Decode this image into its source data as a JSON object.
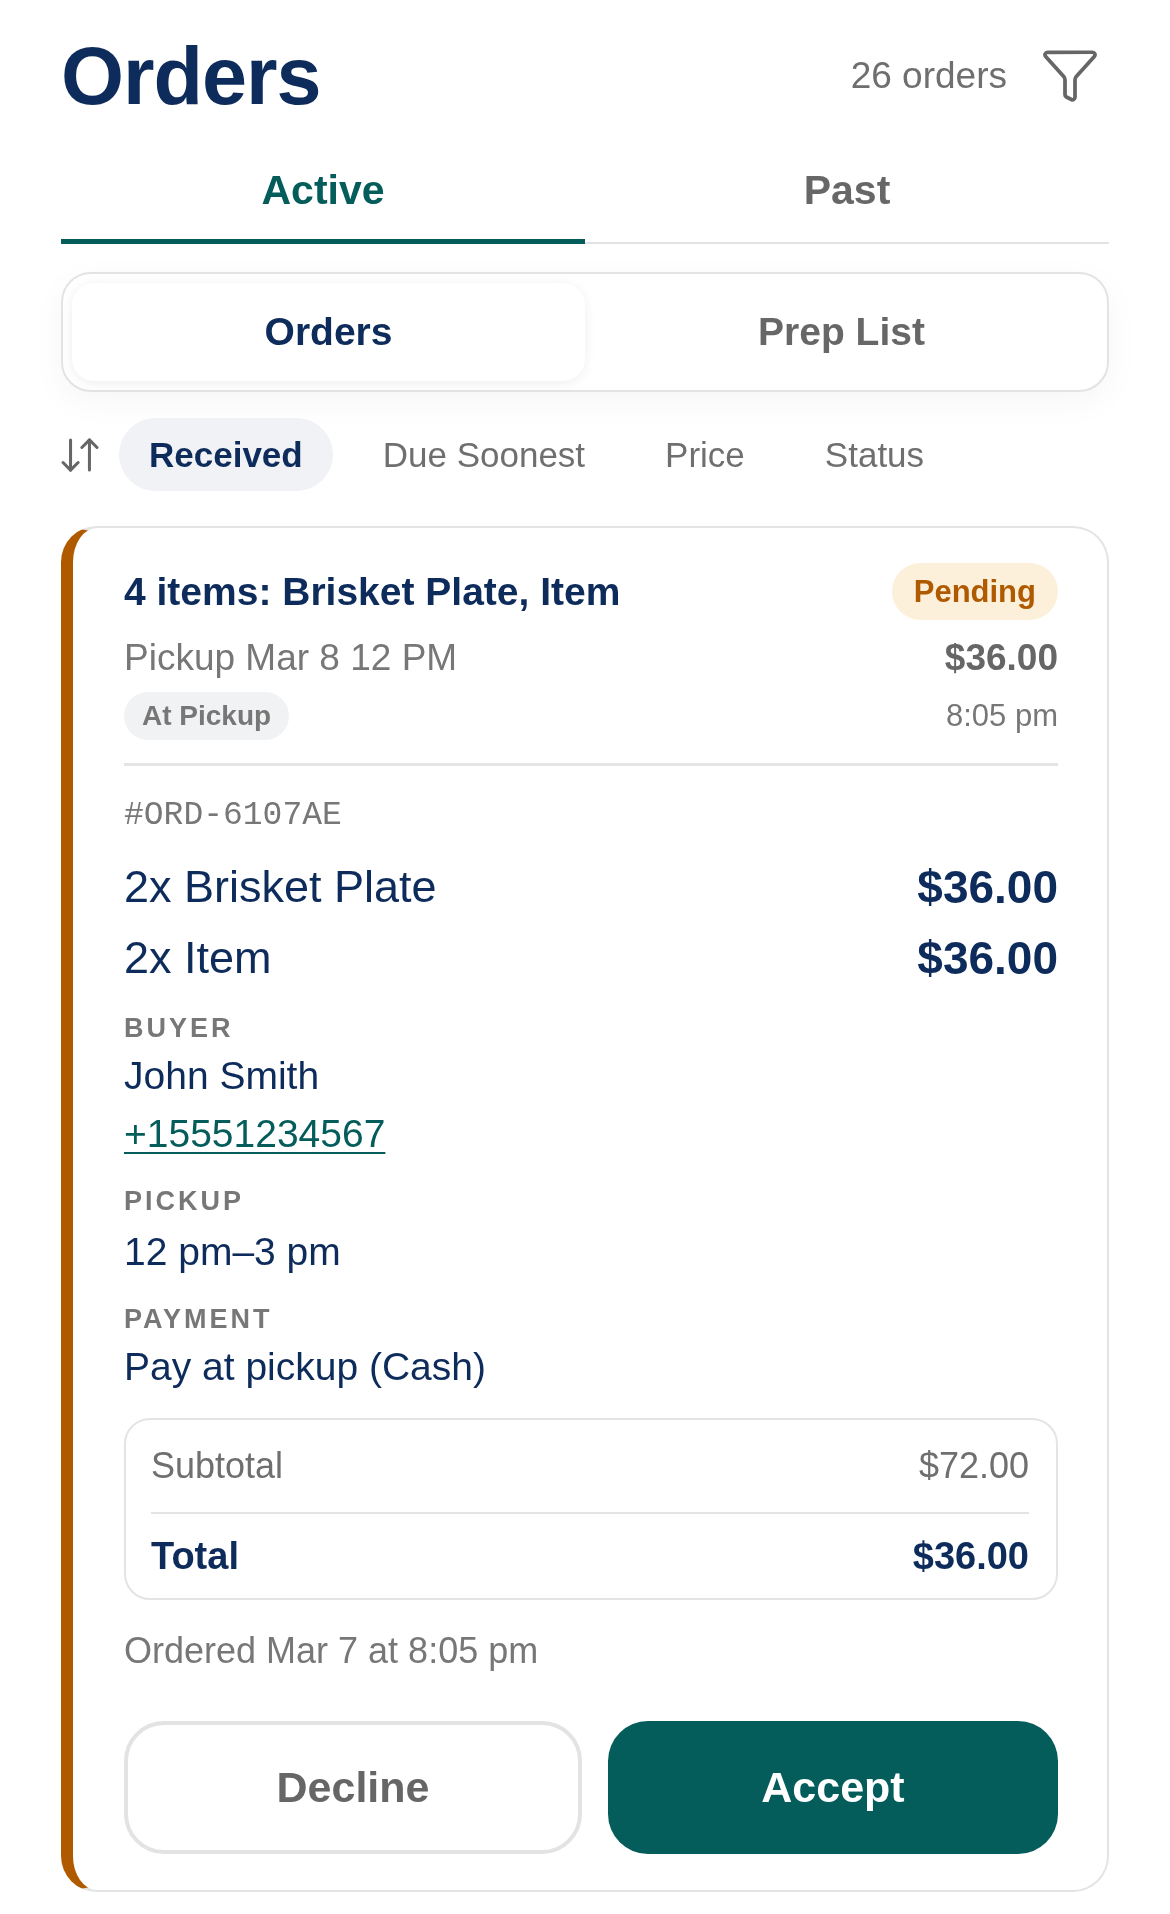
{
  "header": {
    "title": "Orders",
    "count": "26 orders"
  },
  "tabs": [
    {
      "label": "Active",
      "selected": true
    },
    {
      "label": "Past",
      "selected": false
    }
  ],
  "view_switch": [
    {
      "label": "Orders",
      "selected": true
    },
    {
      "label": "Prep List",
      "selected": false
    }
  ],
  "sort_options": [
    {
      "label": "Received",
      "selected": true
    },
    {
      "label": "Due Soonest",
      "selected": false
    },
    {
      "label": "Price",
      "selected": false
    },
    {
      "label": "Status",
      "selected": false
    }
  ],
  "order": {
    "status": {
      "label": "Pending",
      "kind": "pending"
    },
    "summary": "4 items: Brisket Plate, Item",
    "pickup_time": "Pickup Mar 8 12 PM",
    "price": "$36.00",
    "fulfillment": "At Pickup",
    "received_time": "8:05 pm",
    "order_id": "#ORD-6107AE",
    "items": [
      {
        "name": "2x Brisket Plate",
        "price": "$36.00"
      },
      {
        "name": "2x Item",
        "price": "$36.00"
      }
    ],
    "buyer": {
      "label": "BUYER",
      "name": "John Smith",
      "phone": "+15551234567"
    },
    "pickup": {
      "label": "PICKUP",
      "value": "12 pm–3 pm"
    },
    "payment": {
      "label": "PAYMENT",
      "value": "Pay at pickup (Cash)"
    },
    "totals": [
      {
        "label": "Subtotal",
        "value": "$72.00",
        "kind": "subtotal"
      },
      {
        "label": "Total",
        "value": "$36.00",
        "kind": "total"
      }
    ],
    "ordered_at": "Ordered Mar 7 at 8:05 pm",
    "actions": [
      {
        "label": "Decline",
        "kind": "secondary"
      },
      {
        "label": "Accept",
        "kind": "primary"
      }
    ]
  }
}
